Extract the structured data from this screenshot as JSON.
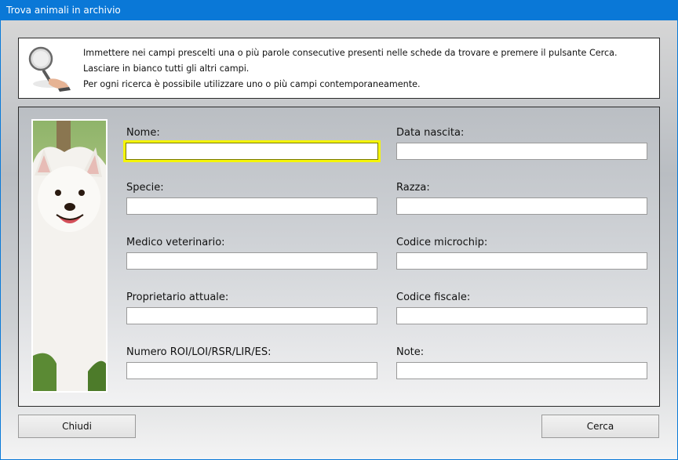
{
  "window": {
    "title": "Trova animali in archivio"
  },
  "info": {
    "lines": [
      "Immettere nei campi prescelti una o più parole consecutive presenti nelle schede da trovare e premere il pulsante Cerca.",
      "Lasciare in bianco tutti gli altri campi.",
      "Per ogni ricerca è possibile utilizzare uno o più campi contemporaneamente."
    ]
  },
  "fields": {
    "nome": {
      "label": "Nome:",
      "value": ""
    },
    "data_nascita": {
      "label": "Data nascita:",
      "value": ""
    },
    "specie": {
      "label": "Specie:",
      "value": ""
    },
    "razza": {
      "label": "Razza:",
      "value": ""
    },
    "medico": {
      "label": "Medico veterinario:",
      "value": ""
    },
    "microchip": {
      "label": "Codice microchip:",
      "value": ""
    },
    "proprietario": {
      "label": "Proprietario attuale:",
      "value": ""
    },
    "codice_fiscale": {
      "label": "Codice fiscale:",
      "value": ""
    },
    "numero_roi": {
      "label": "Numero ROI/LOI/RSR/LIR/ES:",
      "value": ""
    },
    "note": {
      "label": "Note:",
      "value": ""
    }
  },
  "buttons": {
    "close": "Chiudi",
    "search": "Cerca"
  },
  "colors": {
    "titlebar": "#0a78d7",
    "focus_border": "#f4f40a"
  }
}
